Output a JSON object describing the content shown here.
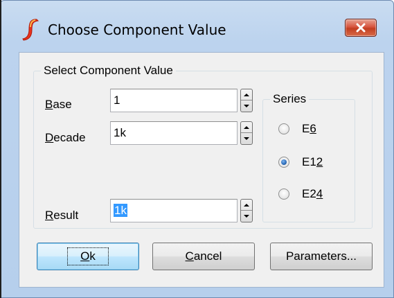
{
  "window": {
    "title": "Choose Component Value",
    "close_symbol": "✕",
    "app_icon": "simetrix-logo-icon"
  },
  "group": {
    "title": "Select Component Value"
  },
  "fields": {
    "base": {
      "label_mnemonic": "B",
      "label_rest": "ase",
      "value": "1"
    },
    "decade": {
      "label_mnemonic": "D",
      "label_rest": "ecade",
      "value": "1k"
    },
    "result": {
      "label_mnemonic": "R",
      "label_rest": "esult",
      "value": "1k"
    }
  },
  "series": {
    "title": "Series",
    "options": [
      {
        "label_main": "E",
        "label_mnemonic": "6",
        "checked": false
      },
      {
        "label_main": "E1",
        "label_mnemonic": "2",
        "checked": true
      },
      {
        "label_main": "E2",
        "label_mnemonic": "4",
        "checked": false
      }
    ]
  },
  "buttons": {
    "ok": {
      "mnemonic": "O",
      "rest": "k"
    },
    "cancel": {
      "mnemonic": "C",
      "rest": "ancel"
    },
    "parameters": {
      "label": "Parameters..."
    }
  },
  "colors": {
    "titlebar": "#bcd3ee",
    "close_button": "#c8452a",
    "selection": "#3399ff",
    "default_button_border": "#3c7fb1"
  }
}
